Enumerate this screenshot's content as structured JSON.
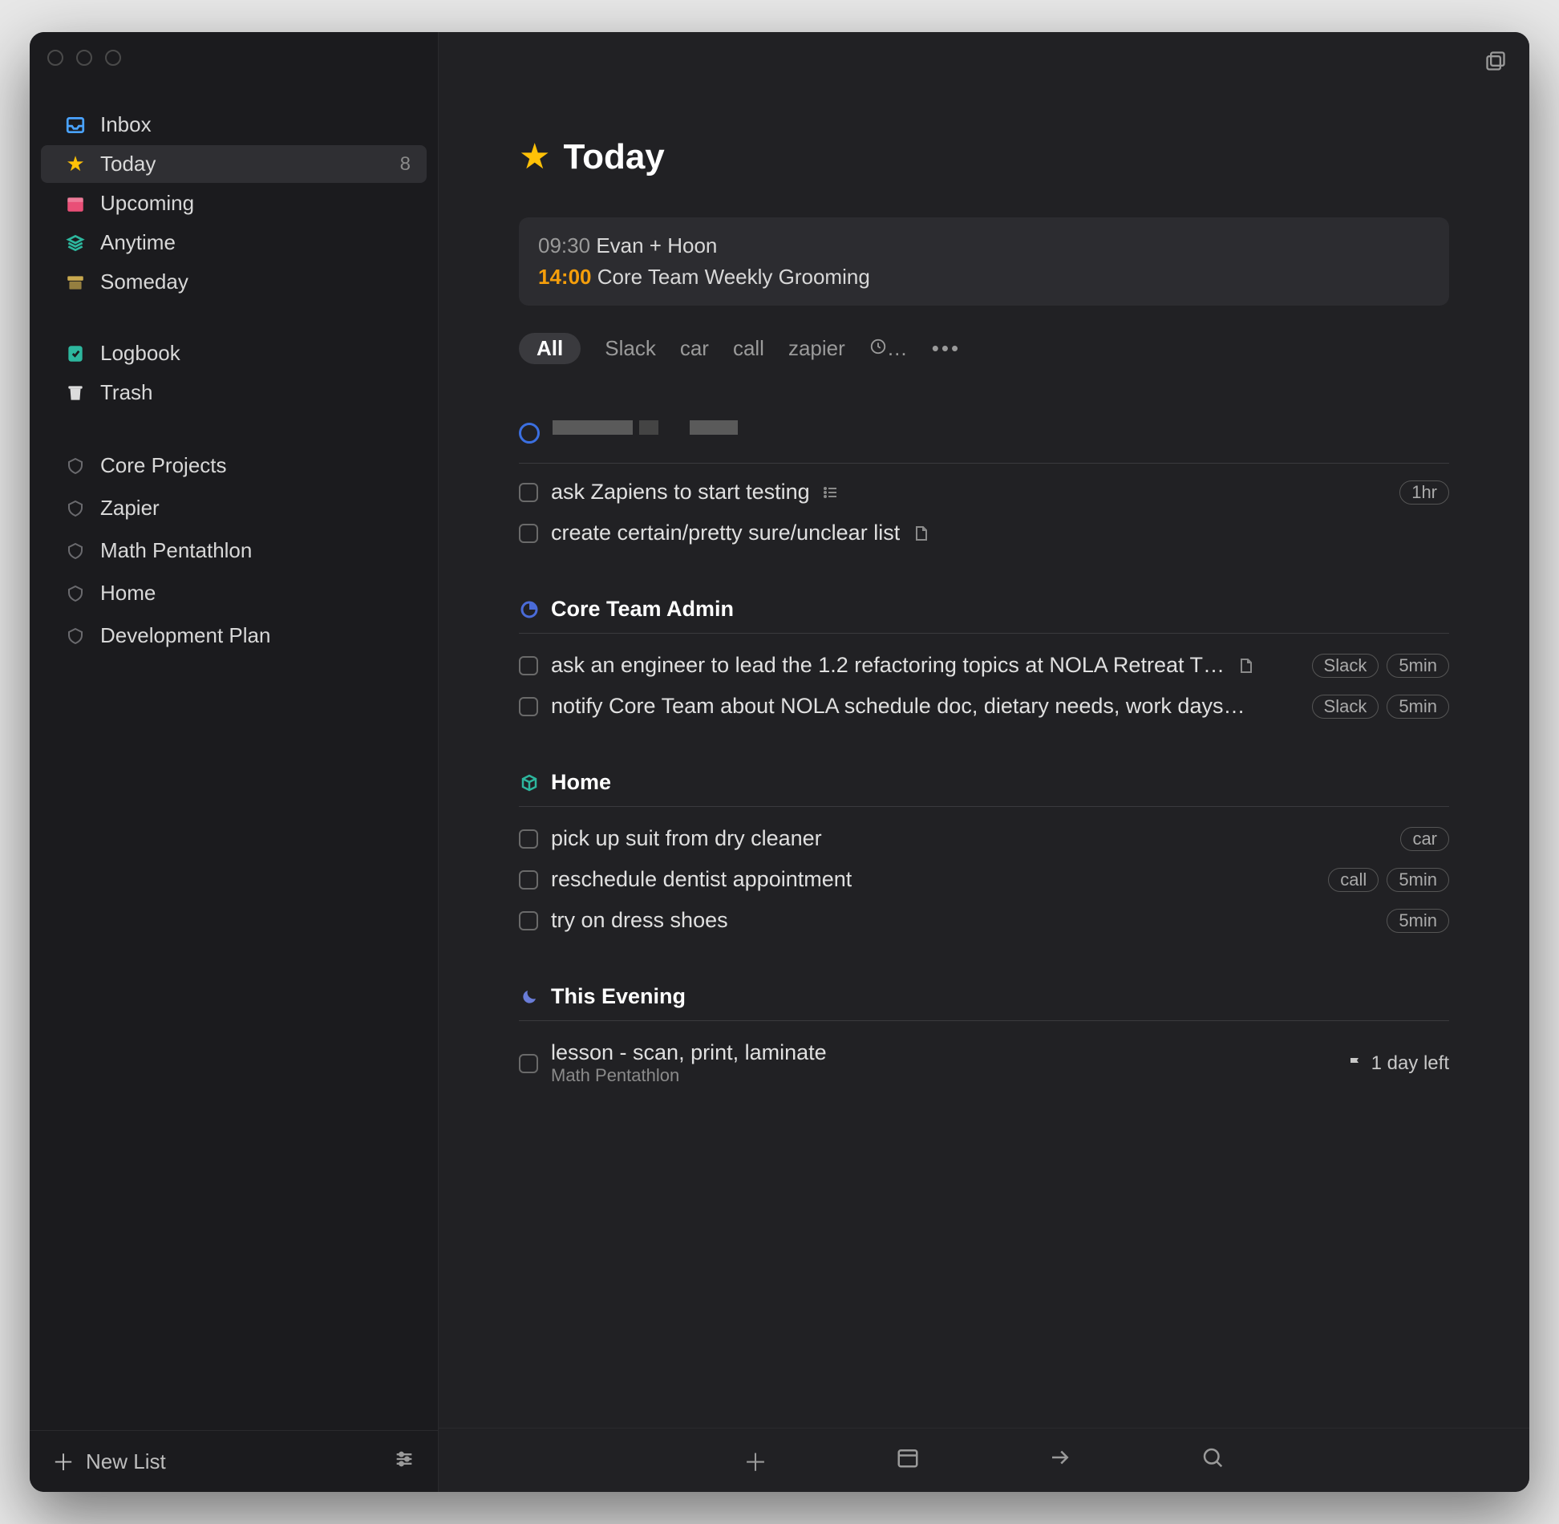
{
  "sidebar": {
    "items": [
      {
        "label": "Inbox",
        "icon": "inbox",
        "color": "#4aa3ff"
      },
      {
        "label": "Today",
        "icon": "star",
        "color": "#ffc107",
        "count": "8",
        "selected": true
      },
      {
        "label": "Upcoming",
        "icon": "calendar",
        "color": "#e94f77"
      },
      {
        "label": "Anytime",
        "icon": "stack",
        "color": "#2db79e"
      },
      {
        "label": "Someday",
        "icon": "archive",
        "color": "#c9a94f"
      }
    ],
    "items2": [
      {
        "label": "Logbook",
        "icon": "logbook",
        "color": "#2db79e"
      },
      {
        "label": "Trash",
        "icon": "trash",
        "color": "#dcdcdc"
      }
    ],
    "areas": [
      {
        "label": "Core Projects"
      },
      {
        "label": "Zapier"
      },
      {
        "label": "Math Pentathlon"
      },
      {
        "label": "Home"
      },
      {
        "label": "Development Plan"
      }
    ],
    "newList": "New List"
  },
  "main": {
    "title": "Today",
    "events": [
      {
        "time": "09:30",
        "title": "Evan + Hoon",
        "highlight": false
      },
      {
        "time": "14:00",
        "title": "Core Team Weekly Grooming",
        "highlight": true
      }
    ],
    "filters": {
      "all": "All",
      "tags": [
        "Slack",
        "car",
        "call",
        "zapier"
      ]
    },
    "ungrouped": [
      {
        "type": "circle",
        "obscured": true
      },
      {
        "text": "ask Zapiens to start testing",
        "listIcon": true,
        "tags": [
          "1hr"
        ]
      },
      {
        "text": "create certain/pretty sure/unclear list",
        "noteIcon": true
      }
    ],
    "sections": [
      {
        "iconColor": "#4a6bd8",
        "icon": "pie",
        "title": "Core Team Admin",
        "tasks": [
          {
            "text": "ask an engineer to lead the 1.2 refactoring topics at NOLA Retreat T…",
            "noteIcon": true,
            "tags": [
              "Slack",
              "5min"
            ]
          },
          {
            "text": "notify Core Team about NOLA schedule doc, dietary needs, work days…",
            "tags": [
              "Slack",
              "5min"
            ]
          }
        ]
      },
      {
        "iconColor": "#2db79e",
        "icon": "box",
        "title": "Home",
        "tasks": [
          {
            "text": "pick up suit from dry cleaner",
            "tags": [
              "car"
            ]
          },
          {
            "text": "reschedule dentist appointment",
            "tags": [
              "call",
              "5min"
            ]
          },
          {
            "text": "try on dress shoes",
            "tags": [
              "5min"
            ]
          }
        ]
      },
      {
        "iconColor": "#6a7dd8",
        "icon": "moon",
        "title": "This Evening",
        "tasks": [
          {
            "text": "lesson - scan, print, laminate",
            "sub": "Math Pentathlon",
            "flag": "1 day left"
          }
        ]
      }
    ]
  }
}
